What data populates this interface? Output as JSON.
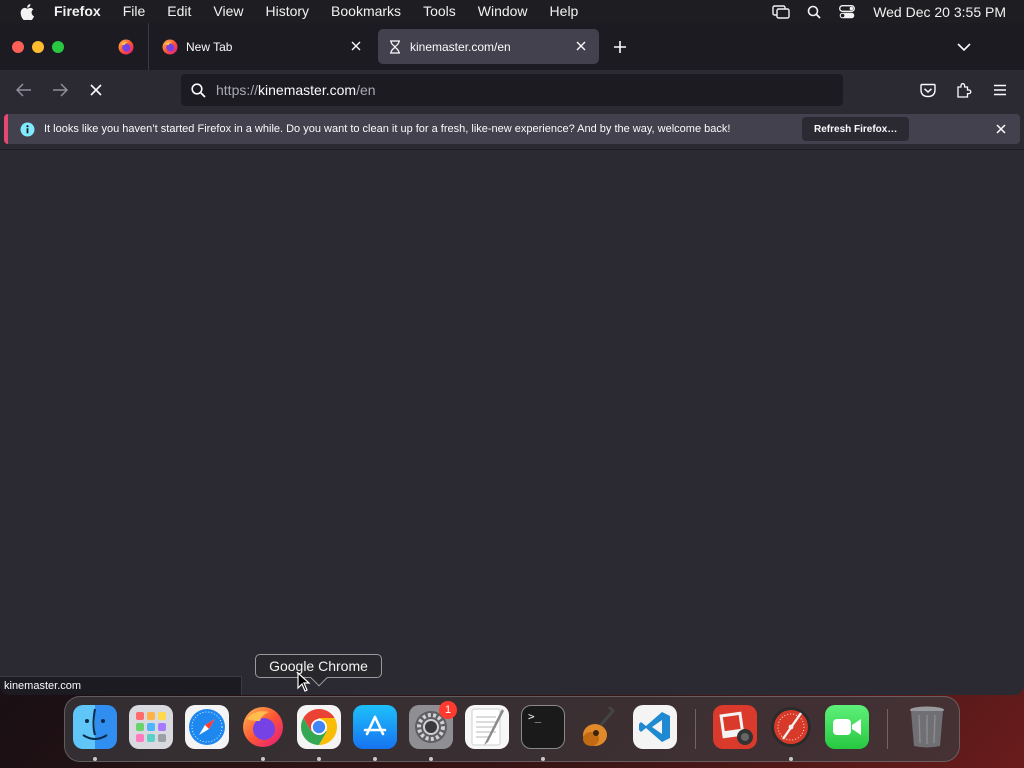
{
  "menubar": {
    "app_name": "Firefox",
    "items": [
      "File",
      "Edit",
      "View",
      "History",
      "Bookmarks",
      "Tools",
      "Window",
      "Help"
    ],
    "clock": "Wed Dec 20  3:55 PM"
  },
  "tabs": {
    "new_tab_title": "New Tab",
    "active_tab_title": "kinemaster.com/en"
  },
  "urlbar": {
    "scheme": "https://",
    "host": "kinemaster.com",
    "path": "/en"
  },
  "notification": {
    "message": "It looks like you haven’t started Firefox in a while. Do you want to clean it up for a fresh, like-new experience? And by the way, welcome back!",
    "button_label": "Refresh Firefox…"
  },
  "statusbar": {
    "text": "kinemaster.com"
  },
  "dock": {
    "tooltip": "Google Chrome",
    "settings_badge": "1",
    "terminal_glyph": ">_"
  },
  "colors": {
    "accent_notification": "#e54872",
    "window_bg": "#2b2a33",
    "toolbar_dark": "#1c1b22"
  }
}
